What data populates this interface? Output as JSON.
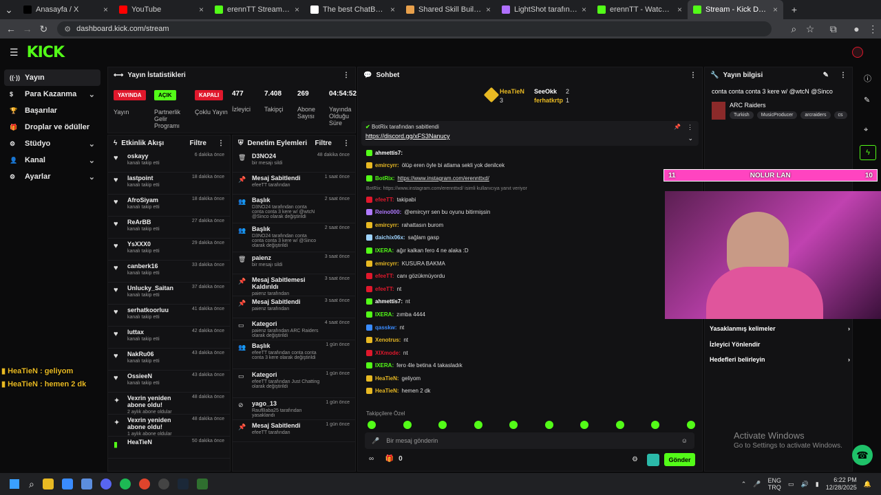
{
  "browser": {
    "tabs": [
      {
        "label": "Anasayfa / X",
        "color": "#000000"
      },
      {
        "label": "YouTube",
        "color": "#ff0000"
      },
      {
        "label": "erennTT Stream - Watch Li",
        "color": "#53fc18"
      },
      {
        "label": "The best ChatBot and Wid",
        "color": "#ffffff"
      },
      {
        "label": "Shared Skill Build | MetaF",
        "color": "#e8a04b"
      },
      {
        "label": "LightShot tarafından Ekra",
        "color": "#b070ff"
      },
      {
        "label": "erennTT - Watch clips on",
        "color": "#53fc18"
      },
      {
        "label": "Stream - Kick Dashboard",
        "color": "#53fc18"
      }
    ],
    "url": "dashboard.kick.com/stream"
  },
  "kick": {
    "logo": "KICK",
    "nav": [
      {
        "label": "Yayın",
        "icon": "broadcast-icon",
        "glyph": "((·))",
        "chevron": false
      },
      {
        "label": "Para Kazanma",
        "icon": "money-icon",
        "glyph": "$",
        "chevron": true
      },
      {
        "label": "Başarılar",
        "icon": "trophy-icon",
        "glyph": "🏆",
        "chevron": false
      },
      {
        "label": "Droplar ve ödüller",
        "icon": "gift-icon",
        "glyph": "🎁",
        "chevron": false
      },
      {
        "label": "Stüdyo",
        "icon": "studio-icon",
        "glyph": "⚙",
        "chevron": true
      },
      {
        "label": "Kanal",
        "icon": "channel-icon",
        "glyph": "👤",
        "chevron": true
      },
      {
        "label": "Ayarlar",
        "icon": "settings-icon",
        "glyph": "⚙",
        "chevron": true
      }
    ]
  },
  "stats": {
    "title": "Yayın İstatistikleri",
    "items": [
      {
        "value": "YAYINDA",
        "label": "Yayın",
        "badge": "#e0182c"
      },
      {
        "value": "AÇIK",
        "label": "Partnerlik Gelir Programı",
        "badge": "#53fc18"
      },
      {
        "value": "KAPALI",
        "label": "Çoklu Yayın",
        "badge": "#e0182c"
      },
      {
        "value": "477",
        "label": "İzleyici",
        "badge": ""
      },
      {
        "value": "7.408",
        "label": "Takipçi",
        "badge": ""
      },
      {
        "value": "269",
        "label": "Abone Sayısı",
        "badge": ""
      },
      {
        "value": "04:54:52",
        "label": "Yayında Olduğu Süre",
        "badge": ""
      }
    ]
  },
  "activity": {
    "title": "Etkinlik Akışı",
    "filter": "Filtre",
    "rows": [
      {
        "name": "oskayy",
        "sub": "kanalı takip etti",
        "time": "6 dakika önce"
      },
      {
        "name": "lastpoint",
        "sub": "kanalı takip etti",
        "time": "18 dakika önce"
      },
      {
        "name": "AfroSiyam",
        "sub": "kanalı takip etti",
        "time": "18 dakika önce"
      },
      {
        "name": "ReArBB",
        "sub": "kanalı takip etti",
        "time": "27 dakika önce"
      },
      {
        "name": "YsXXX0",
        "sub": "kanalı takip etti",
        "time": "29 dakika önce"
      },
      {
        "name": "canberk16",
        "sub": "kanalı takip etti",
        "time": "33 dakika önce"
      },
      {
        "name": "Unlucky_Saitan",
        "sub": "kanalı takip etti",
        "time": "37 dakika önce"
      },
      {
        "name": "serhatkoorluu",
        "sub": "kanalı takip etti",
        "time": "41 dakika önce"
      },
      {
        "name": "luttax",
        "sub": "kanalı takip etti",
        "time": "42 dakika önce"
      },
      {
        "name": "NakRu06",
        "sub": "kanalı takip etti",
        "time": "43 dakika önce"
      },
      {
        "name": "OssieeN",
        "sub": "kanalı takip etti",
        "time": "43 dakika önce"
      },
      {
        "name": "Vexrin yeniden abone oldu!",
        "sub": "2 aylık abone oldular",
        "time": "48 dakika önce"
      },
      {
        "name": "Vexrin yeniden abone oldu!",
        "sub": "1 aylık abone oldular",
        "time": "48 dakika önce"
      },
      {
        "name": "HeaTieN",
        "sub": "",
        "time": "50 dakika önce"
      }
    ]
  },
  "moderation": {
    "title": "Denetim Eylemleri",
    "filter": "Filtre",
    "rows": [
      {
        "name": "D3NO24",
        "sub": "bir mesajı sildi",
        "time": "48 dakika önce"
      },
      {
        "name": "Mesaj Sabitlendi",
        "sub": "efeeTT tarafından",
        "time": "1 saat önce"
      },
      {
        "name": "Başlık",
        "sub": "D3NO24 tarafından conta conta conta 3 kere w/ @wtcN @Sinco olarak değiştirildi",
        "time": "2 saat önce"
      },
      {
        "name": "Başlık",
        "sub": "D3NO24 tarafından conta conta conta 3 kere w/ @Sinco olarak değiştirildi",
        "time": "2 saat önce"
      },
      {
        "name": "paienz",
        "sub": "bir mesajı sildi",
        "time": "3 saat önce"
      },
      {
        "name": "Mesaj Sabitlemesi Kaldırıldı",
        "sub": "paienz tarafından",
        "time": "3 saat önce"
      },
      {
        "name": "Mesaj Sabitlendi",
        "sub": "paienz tarafından",
        "time": "3 saat önce"
      },
      {
        "name": "Kategori",
        "sub": "paienz tarafından ARC Raiders olarak değiştirildi",
        "time": "4 saat önce"
      },
      {
        "name": "Başlık",
        "sub": "efeeTT tarafından conta conta conta 3 kere olarak değiştirildi",
        "time": "1 gün önce"
      },
      {
        "name": "Kategori",
        "sub": "efeeTT tarafından Just Chatting olarak değiştirildi",
        "time": "1 gün önce"
      },
      {
        "name": "yago_13",
        "sub": "RaufBaba25 tarafından yasaklandı",
        "time": "1 gün önce"
      },
      {
        "name": "Mesaj Sabitlendi",
        "sub": "efeeTT tarafından",
        "time": "1 gün önce"
      }
    ]
  },
  "chat": {
    "title": "Sohbet",
    "top": [
      {
        "name": "HeaTieN",
        "count": "3"
      },
      {
        "name": "SeeOkk",
        "count": "2"
      },
      {
        "name": "ferhatkrtp",
        "count": "1"
      }
    ],
    "pinned_by": "BotRix tarafından sabitlendi",
    "pinned_link": "https://discord.gg/xFS3Nanucy",
    "reply_hint": "BotRix: https://www.instagram.com/erennttxd/ isimli kullanıcıya yanıt veriyor",
    "messages": [
      {
        "user": "ahmettis7:",
        "text": "",
        "color": "#ffffff"
      },
      {
        "user": "emircyrr:",
        "text": "ölüp eren öyle bi atlama sekli yok denilcek",
        "color": "#e8b923"
      },
      {
        "user": "BotRix:",
        "text": "https://www.instagram.com/erennttxd/",
        "color": "#53fc18"
      },
      {
        "user": "efeeTT:",
        "text": "takipabi",
        "color": "#e0182c"
      },
      {
        "user": "Reino000:",
        "text": "@emircyrr sen bu oyunu bitirmişsin",
        "color": "#b07aff"
      },
      {
        "user": "emircyrr:",
        "text": "rahattasın burom",
        "color": "#e8b923"
      },
      {
        "user": "daichix06x:",
        "text": "sağlam gasp",
        "color": "#9fd4ff"
      },
      {
        "user": "IXERA:",
        "text": "ağır kalkan fero 4 ne alaka :D",
        "color": "#53fc18"
      },
      {
        "user": "emircyrr:",
        "text": "KUSURA BAKMA",
        "color": "#e8b923"
      },
      {
        "user": "efeeTT:",
        "text": "canı gözükmüyordu",
        "color": "#e0182c"
      },
      {
        "user": "efeeTT:",
        "text": "nt",
        "color": "#e0182c"
      },
      {
        "user": "ahmettis7:",
        "text": "nt",
        "color": "#ffffff"
      },
      {
        "user": "IXERA:",
        "text": "zımba 4444",
        "color": "#53fc18"
      },
      {
        "user": "qasskw:",
        "text": "nt",
        "color": "#3a8cff"
      },
      {
        "user": "Xenotrus:",
        "text": "nt",
        "color": "#e8b923"
      },
      {
        "user": "XIXmode:",
        "text": "nt",
        "color": "#e0182c"
      },
      {
        "user": "IXERA:",
        "text": "fero 4le betina 4 takasladık",
        "color": "#53fc18"
      },
      {
        "user": "HeaTieN:",
        "text": "geliyom",
        "color": "#e8b923"
      },
      {
        "user": "HeaTieN:",
        "text": "hemen 2 dk",
        "color": "#e8b923"
      }
    ],
    "followers_only": "Takipçilere Özel",
    "placeholder": "Bir mesaj gönderin",
    "send": "Gönder",
    "points": "0"
  },
  "stream_info": {
    "title": "Yayın bilgisi",
    "stream_title": "conta conta conta 3 kere w/ @wtcN @Sinco",
    "category": "ARC Raiders",
    "tags": [
      "Turkish",
      "MusicProducer",
      "arcraiders",
      "cs"
    ],
    "menu": [
      "Yasaklanmış kelimeler",
      "İzleyici Yönlendir",
      "Hedefleri belirleyin"
    ]
  },
  "overlay": {
    "left": "11",
    "center": "NOLUR LAN",
    "right": "10",
    "chat1": "HeaTieN : geliyom",
    "chat2": "HeaTieN : hemen 2 dk"
  },
  "watermark": {
    "line1": "Activate Windows",
    "line2": "Go to Settings to activate Windows."
  },
  "taskbar": {
    "lang": "ENG",
    "lang2": "TRQ",
    "time": "6:22 PM",
    "date": "12/28/2025"
  }
}
